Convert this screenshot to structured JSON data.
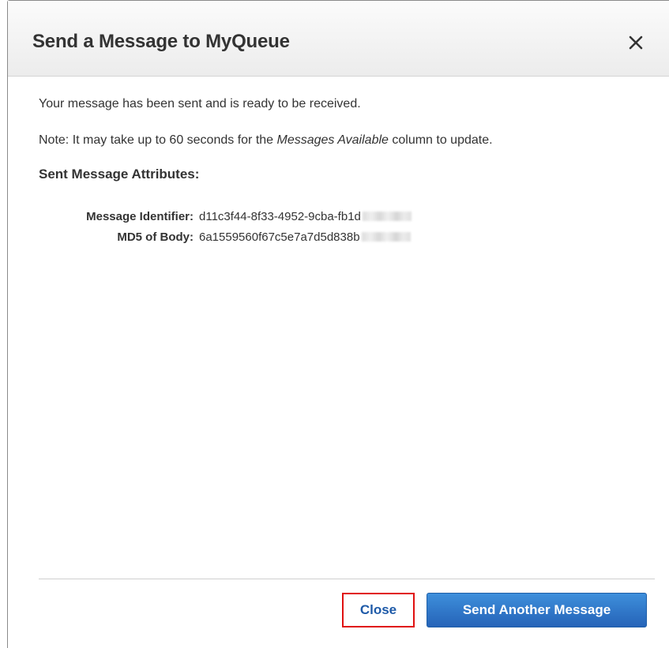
{
  "dialog": {
    "title": "Send a Message to MyQueue",
    "close_icon": "close-x-icon"
  },
  "body": {
    "confirmation": "Your message has been sent and is ready to be received.",
    "note_prefix": "Note: It may take up to 60 seconds for the ",
    "note_emphasis": "Messages Available",
    "note_suffix": " column to update.",
    "section_title": "Sent Message Attributes:",
    "attributes": [
      {
        "label": "Message Identifier:",
        "value": "d11c3f44-8f33-4952-9cba-fb1d"
      },
      {
        "label": "MD5 of Body:",
        "value": "6a1559560f67c5e7a7d5d838b"
      }
    ]
  },
  "footer": {
    "close_label": "Close",
    "send_another_label": "Send Another Message"
  },
  "colors": {
    "primary_button": "#2d74c8",
    "close_link": "#1e5aa8",
    "highlight_box": "#e01010"
  }
}
